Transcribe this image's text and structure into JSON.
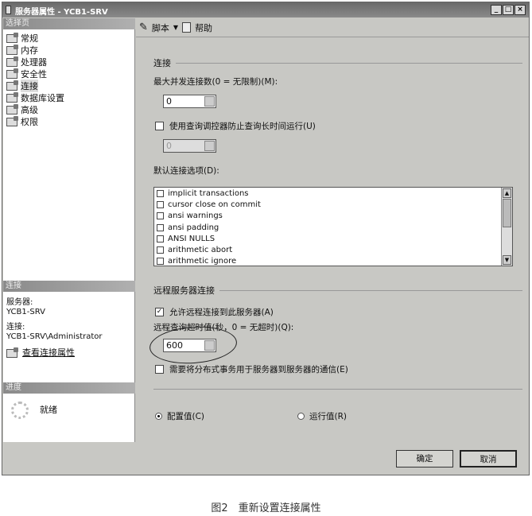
{
  "window": {
    "title": "服务器属性 - YCB1-SRV",
    "controls": [
      "_",
      "□",
      "×"
    ]
  },
  "left": {
    "select_page_header": "选择页",
    "items": [
      {
        "label": "常规"
      },
      {
        "label": "内存"
      },
      {
        "label": "处理器"
      },
      {
        "label": "安全性"
      },
      {
        "label": "连接",
        "selected": true
      },
      {
        "label": "数据库设置"
      },
      {
        "label": "高级"
      },
      {
        "label": "权限"
      }
    ],
    "connection_header": "连接",
    "server_label": "服务器:",
    "server_value": "YCB1-SRV",
    "conn_label": "连接:",
    "conn_value": "YCB1-SRV\\Administrator",
    "view_props_link": "查看连接属性",
    "progress_header": "进度",
    "progress_status": "就绪"
  },
  "toolbar": {
    "script": "脚本",
    "help": "帮助"
  },
  "main": {
    "conn_group": "连接",
    "max_conn_label": "最大并发连接数(0 = 无限制)(M):",
    "max_conn_value": "0",
    "governor_label": "使用查询调控器防止查询长时间运行(U)",
    "governor_checked": false,
    "governor_value": "0",
    "default_opts_label": "默认连接选项(D):",
    "options": [
      {
        "label": "implicit transactions",
        "checked": false
      },
      {
        "label": "cursor close on commit",
        "checked": false
      },
      {
        "label": "ansi warnings",
        "checked": false
      },
      {
        "label": "ansi padding",
        "checked": false
      },
      {
        "label": "ANSI NULLS",
        "checked": false
      },
      {
        "label": "arithmetic abort",
        "checked": false
      },
      {
        "label": "arithmetic ignore",
        "checked": false
      }
    ],
    "remote_group": "远程服务器连接",
    "allow_remote_label": "允许远程连接到此服务器(A)",
    "allow_remote_checked": true,
    "timeout_label": "远程查询超时值(秒，0 = 无超时)(Q):",
    "timeout_value": "600",
    "dtc_label": "需要将分布式事务用于服务器到服务器的通信(E)",
    "dtc_checked": false,
    "config_radio": "配置值(C)",
    "running_radio": "运行值(R)",
    "selected_radio": "config"
  },
  "buttons": {
    "ok": "确定",
    "cancel": "取消"
  },
  "caption": "图2　重新设置连接属性"
}
